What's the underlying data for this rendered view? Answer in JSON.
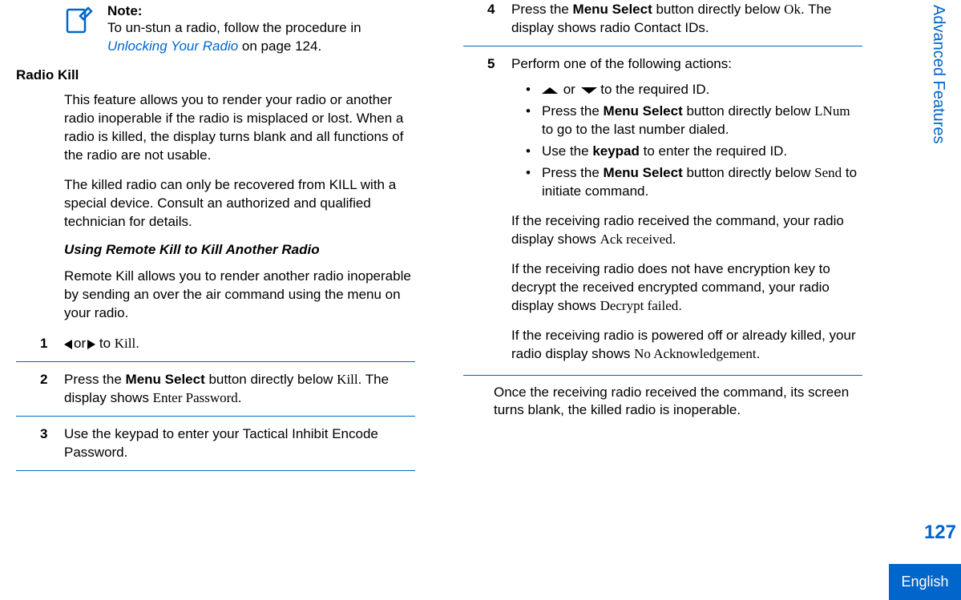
{
  "note": {
    "title": "Note:",
    "line1": "To un-stun a radio, follow the procedure in ",
    "link": "Unlocking Your Radio",
    "line2": " on page 124."
  },
  "radioKill": {
    "heading": "Radio Kill",
    "p1": "This feature allows you to render your radio or another radio inoperable if the radio is misplaced or lost. When a radio is killed, the display turns blank and all functions of the radio are not usable.",
    "p2": "The killed radio can only be recovered from KILL with a special device. Consult an authorized and qualified technician for details."
  },
  "remoteKill": {
    "heading": "Using Remote Kill to Kill Another Radio",
    "intro": "Remote Kill allows you to render another radio inoperable by sending an over the air command using the menu on your radio."
  },
  "steps": {
    "s1": {
      "num": "1",
      "or": "or",
      "to": "to ",
      "kill": "Kill",
      "end": "."
    },
    "s2": {
      "num": "2",
      "a": "Press the ",
      "b": "Menu Select",
      "c": " button directly below ",
      "d": "Kill",
      "e": ". The display shows ",
      "f": "Enter Password",
      "g": "."
    },
    "s3": {
      "num": "3",
      "text": "Use the keypad to enter your Tactical Inhibit Encode Password."
    },
    "s4": {
      "num": "4",
      "a": "Press the ",
      "b": "Menu Select",
      "c": " button directly below ",
      "d": "Ok",
      "e": ". The display shows radio Contact IDs."
    },
    "s5": {
      "num": "5",
      "intro": "Perform one of the following actions:",
      "b1a": " or ",
      "b1b": " to the required ID.",
      "b2a": "Press the ",
      "b2b": "Menu Select",
      "b2c": " button directly below ",
      "b2d": "LNum",
      "b2e": " to go to the last number dialed.",
      "b3a": "Use the ",
      "b3b": "keypad",
      "b3c": " to enter the required ID.",
      "b4a": "Press the ",
      "b4b": "Menu Select",
      "b4c": " button directly below ",
      "b4d": "Send",
      "b4e": " to initiate command.",
      "r1a": "If the receiving radio received the command, your radio display shows ",
      "r1b": "Ack received",
      "r1c": ".",
      "r2a": "If the receiving radio does not have encryption key to decrypt the received encrypted command, your radio display shows ",
      "r2b": "Decrypt failed",
      "r2c": ".",
      "r3a": "If the receiving radio is powered off or already killed, your radio display shows ",
      "r3b": "No Acknowledgement",
      "r3c": "."
    }
  },
  "closing": "Once the receiving radio received the command, its screen turns blank, the killed radio is inoperable.",
  "tab": "Advanced Features",
  "pageNum": "127",
  "lang": "English"
}
